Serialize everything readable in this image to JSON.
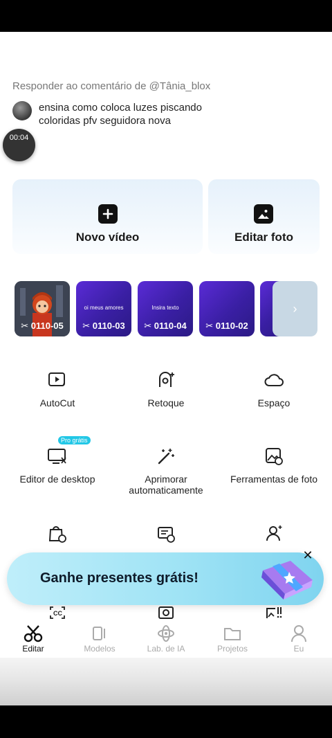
{
  "reply": {
    "title": "Responder ao comentário de @Tânia_blox",
    "comment": "ensina como coloca luzes piscando coloridas pfv seguidora nova",
    "timer": "00:04"
  },
  "cards": [
    {
      "label": "Novo vídeo",
      "icon": "plus-square-icon"
    },
    {
      "label": "Editar foto",
      "icon": "photo-icon"
    }
  ],
  "projects": [
    {
      "caption": "0110-05"
    },
    {
      "caption": "0110-03",
      "text": "oi meus amores"
    },
    {
      "caption": "0110-04",
      "text": "Insira texto"
    },
    {
      "caption": "0110-02"
    }
  ],
  "tools": [
    {
      "label": "AutoCut",
      "icon": "autocut-icon"
    },
    {
      "label": "Retoque",
      "icon": "retouch-icon"
    },
    {
      "label": "Espaço",
      "icon": "cloud-icon"
    },
    {
      "label": "Editor de desktop",
      "icon": "desktop-editor-icon",
      "badge": "Pro grátis"
    },
    {
      "label": "Aprimorar automaticamente",
      "icon": "magic-wand-icon"
    },
    {
      "label": "Ferramentas de foto",
      "icon": "photo-tools-icon"
    }
  ],
  "promo": {
    "text": "Ganhe presentes grátis!",
    "close": "✕"
  },
  "nav": [
    {
      "label": "Editar",
      "icon": "scissors-icon",
      "active": true
    },
    {
      "label": "Modelos",
      "icon": "templates-icon"
    },
    {
      "label": "Lab. de IA",
      "icon": "ai-lab-icon"
    },
    {
      "label": "Projetos",
      "icon": "folder-icon"
    },
    {
      "label": "Eu",
      "icon": "profile-icon"
    }
  ],
  "colors": {
    "accent": "#22c7e6",
    "purple": "#3a1fa4",
    "promo": "#9fe3f5"
  }
}
